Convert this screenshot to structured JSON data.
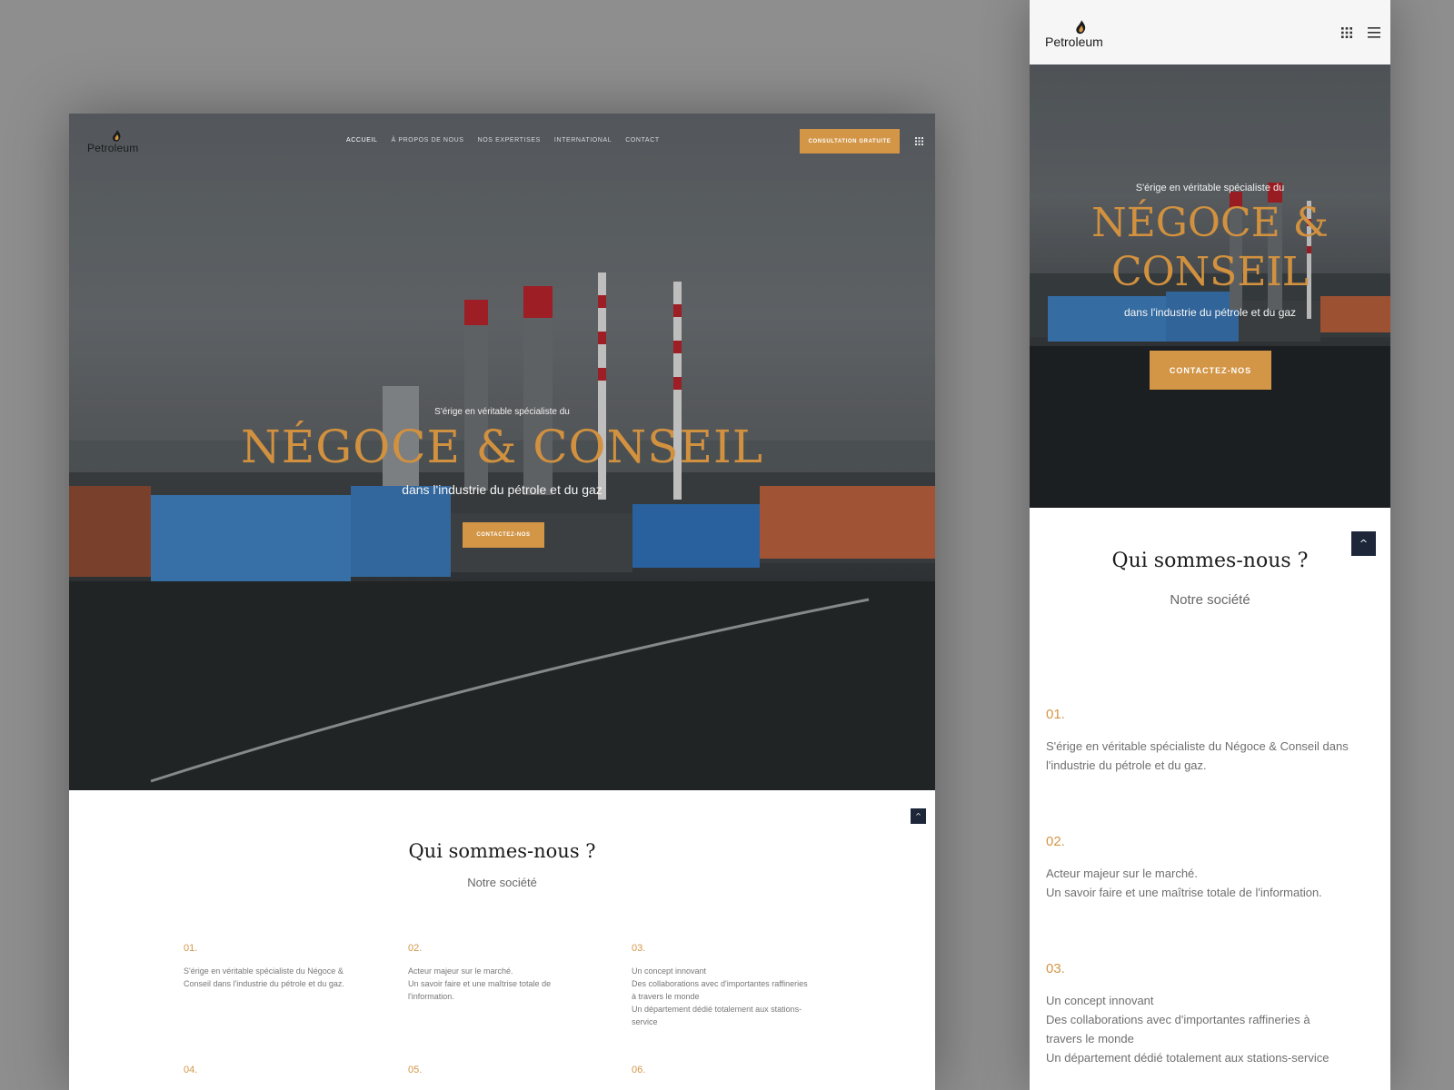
{
  "brand": {
    "name": "Petroleum",
    "accent": "#d39647",
    "dark": "#1d2739"
  },
  "desktop": {
    "nav": [
      {
        "label": "ACCUEIL",
        "active": true
      },
      {
        "label": "À PROPOS DE NOUS",
        "active": false
      },
      {
        "label": "NOS EXPERTISES",
        "active": false
      },
      {
        "label": "INTERNATIONAL",
        "active": false
      },
      {
        "label": "CONTACT",
        "active": false
      }
    ],
    "cta_label": "CONSULTATION GRATUITE",
    "hero": {
      "kicker": "S'érige en véritable spécialiste du",
      "title": "NÉGOCE & CONSEIL",
      "subtitle": "dans l'industrie du pétrole et du gaz",
      "button": "CONTACTEZ-NOS"
    },
    "section": {
      "title": "Qui sommes-nous ?",
      "subtitle": "Notre société",
      "features": [
        {
          "num": "01.",
          "lines": [
            "S'érige en véritable spécialiste du Négoce &",
            "Conseil dans l'industrie du pétrole et du gaz."
          ]
        },
        {
          "num": "02.",
          "lines": [
            "Acteur majeur sur le marché.",
            "Un savoir faire et une maîtrise totale de",
            "l'information."
          ]
        },
        {
          "num": "03.",
          "lines": [
            "Un concept innovant",
            "Des collaborations avec d'importantes raffineries",
            "à travers le monde",
            "Un département dédié totalement aux stations-",
            "service"
          ]
        },
        {
          "num": "04.",
          "lines": []
        },
        {
          "num": "05.",
          "lines": []
        },
        {
          "num": "06.",
          "lines": []
        }
      ]
    }
  },
  "mobile": {
    "hero": {
      "kicker": "S'érige en véritable spécialiste du",
      "title_line1": "NÉGOCE &",
      "title_line2": "CONSEIL",
      "subtitle": "dans l'industrie du pétrole et du gaz",
      "button": "CONTACTEZ-NOS"
    },
    "section": {
      "title": "Qui sommes-nous ?",
      "subtitle": "Notre société",
      "features": [
        {
          "num": "01.",
          "lines": [
            "S'érige en véritable spécialiste du Négoce & Conseil dans",
            "l'industrie du pétrole et du gaz."
          ]
        },
        {
          "num": "02.",
          "lines": [
            "Acteur majeur sur le marché.",
            "Un savoir faire et une maîtrise totale de l'information."
          ]
        },
        {
          "num": "03.",
          "lines": [
            "Un concept innovant",
            "Des collaborations avec d'importantes raffineries à",
            "travers le monde",
            "Un département dédié totalement aux stations-service"
          ]
        }
      ]
    }
  },
  "icons": {
    "grid": "grid-icon",
    "menu": "menu-icon",
    "scroll_top": "chevron-up-icon",
    "logo": "flame-logo-icon"
  }
}
